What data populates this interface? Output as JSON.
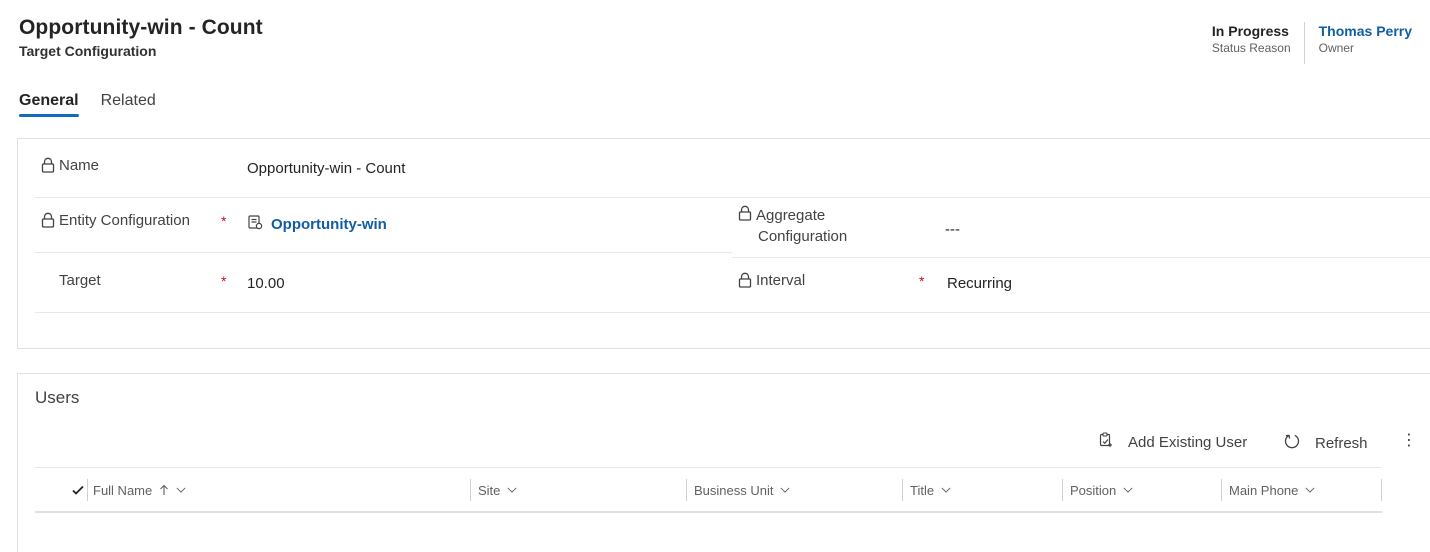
{
  "header": {
    "title": "Opportunity-win - Count",
    "subtitle": "Target Configuration",
    "status_value": "In Progress",
    "status_label": "Status Reason",
    "owner_value": "Thomas Perry",
    "owner_label": "Owner"
  },
  "tabs": [
    {
      "label": "General",
      "active": true
    },
    {
      "label": "Related",
      "active": false
    }
  ],
  "general": {
    "name_label": "Name",
    "name_value": "Opportunity-win - Count",
    "entity_label": "Entity Configuration",
    "entity_value": "Opportunity-win",
    "aggregate_label_line1": "Aggregate",
    "aggregate_label_line2": "Configuration",
    "aggregate_value": "---",
    "target_label": "Target",
    "target_value": "10.00",
    "interval_label": "Interval",
    "interval_value": "Recurring",
    "required_mark": "*"
  },
  "users": {
    "title": "Users",
    "add_existing_label": "Add Existing User",
    "refresh_label": "Refresh",
    "more_label": "⋮",
    "columns": [
      "Full Name",
      "Site",
      "Business Unit",
      "Title",
      "Position",
      "Main Phone"
    ]
  },
  "colors": {
    "accent": "#0f6cbd",
    "link": "#115ea3",
    "required": "#c50f1f"
  }
}
